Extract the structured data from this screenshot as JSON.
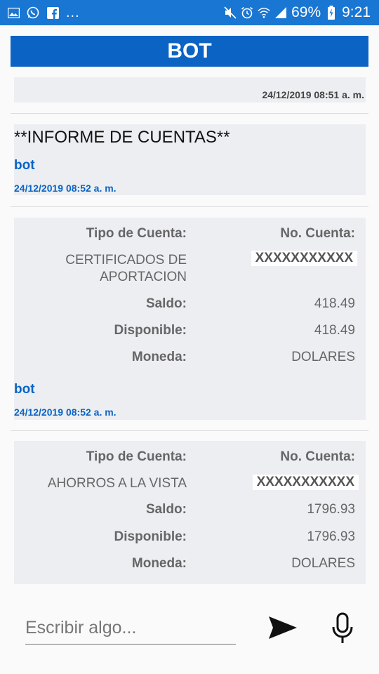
{
  "status_bar": {
    "battery": "69%",
    "time": "9:21",
    "overflow": "..."
  },
  "header": {
    "title": "BOT"
  },
  "messages": [
    {
      "timestamp": "24/12/2019 08:51 a. m."
    },
    {
      "title": "**INFORME DE CUENTAS**",
      "sender": "bot",
      "timestamp": "24/12/2019 08:52 a. m."
    },
    {
      "labels": {
        "account_type": "Tipo de Cuenta:",
        "account_no": "No. Cuenta:",
        "balance": "Saldo:",
        "available": "Disponible:",
        "currency": "Moneda:"
      },
      "account_type": "CERTIFICADOS DE APORTACION",
      "account_no": "XXXXXXXXXXX",
      "balance": "418.49",
      "available": "418.49",
      "currency": "DOLARES",
      "sender": "bot",
      "timestamp": "24/12/2019 08:52 a. m."
    },
    {
      "labels": {
        "account_type": "Tipo de Cuenta:",
        "account_no": "No. Cuenta:",
        "balance": "Saldo:",
        "available": "Disponible:",
        "currency": "Moneda:"
      },
      "account_type": "AHORROS A LA VISTA",
      "account_no": "XXXXXXXXXXX",
      "balance": "1796.93",
      "available": "1796.93",
      "currency": "DOLARES"
    }
  ],
  "composer": {
    "placeholder": "Escribir algo...",
    "send_icon": "send-icon",
    "mic_icon": "microphone-icon"
  },
  "colors": {
    "status_bar": "#1976d2",
    "header": "#0b63c4",
    "accent_text": "#0b63c4",
    "bubble": "#eceef1"
  }
}
